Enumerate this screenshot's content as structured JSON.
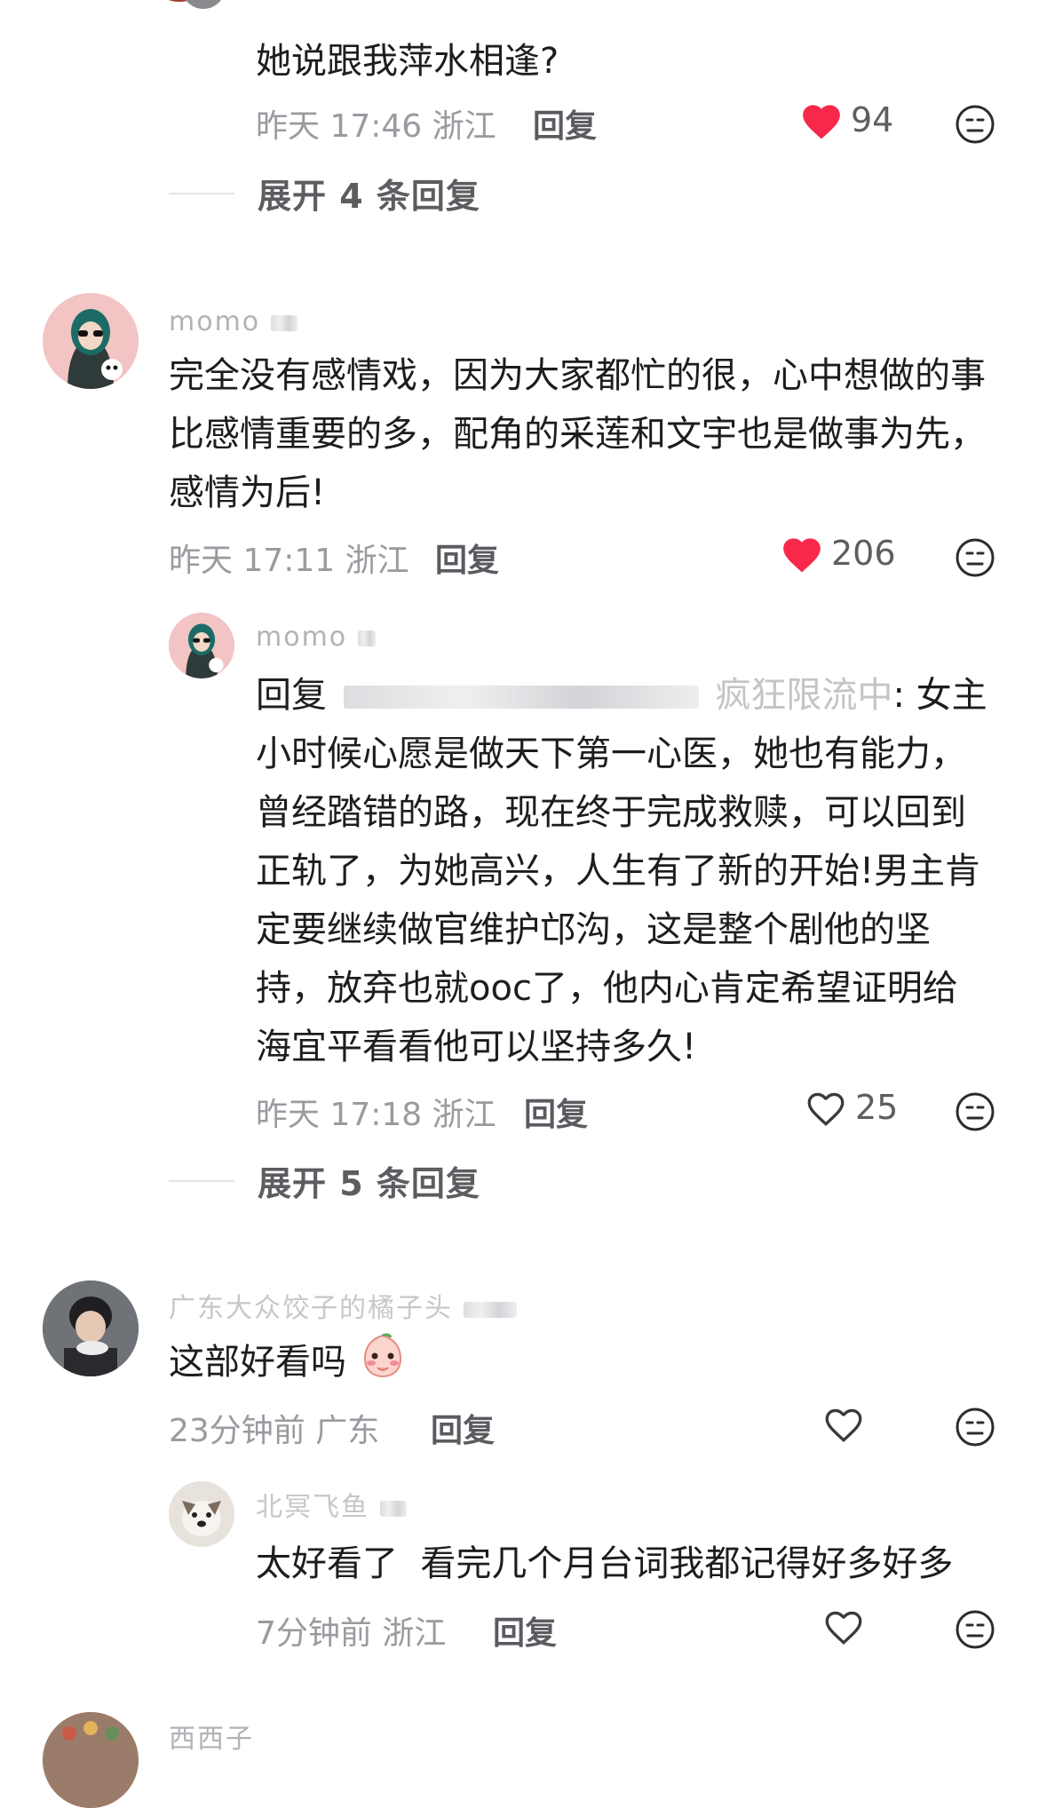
{
  "thread1": {
    "reply_text": "她说跟我萍水相逢?",
    "time_location": "昨天 17:46 浙江",
    "reply_label": "回复",
    "likes": "94",
    "liked": true,
    "expand_label": "展开 4 条回复"
  },
  "comment2": {
    "username": "momo",
    "text": "完全没有感情戏，因为大家都忙的很，心中想做的事比感情重要的多，配角的采莲和文宇也是做事为先，感情为后!",
    "time_location": "昨天 17:11 浙江",
    "reply_label": "回复",
    "likes": "206",
    "liked": true,
    "reply": {
      "username": "momo",
      "reply_prefix": "回复",
      "reply_target_visible": "疯狂限流中",
      "text": ": 女主小时候心愿是做天下第一心医，她也有能力，曾经踏错的路，现在终于完成救赎，可以回到正轨了，为她高兴，人生有了新的开始!男主肯定要继续做官维护邙沟，这是整个剧他的坚持，放弃也就ooc了，他内心肯定希望证明给海宜平看看他可以坚持多久!",
      "time_location": "昨天 17:18 浙江",
      "reply_label": "回复",
      "likes": "25",
      "liked": false
    },
    "expand_label": "展开 5 条回复"
  },
  "comment3": {
    "username": "广东大众饺子的橘子头",
    "text": "这部好看吗",
    "emoji_icon": "shy-peach-face-emoji",
    "time_location": "23分钟前 广东",
    "reply_label": "回复",
    "liked": false,
    "reply": {
      "username": "北冥飞鱼",
      "text": "太好看了  看完几个月台词我都记得好多好多",
      "time_location": "7分钟前 浙江",
      "reply_label": "回复",
      "liked": false
    }
  },
  "comment4": {
    "username": "西西子"
  },
  "colors": {
    "like_red": "#f8284a",
    "meta_gray": "#9a9aa0",
    "reply_gray": "#5a5a60"
  }
}
